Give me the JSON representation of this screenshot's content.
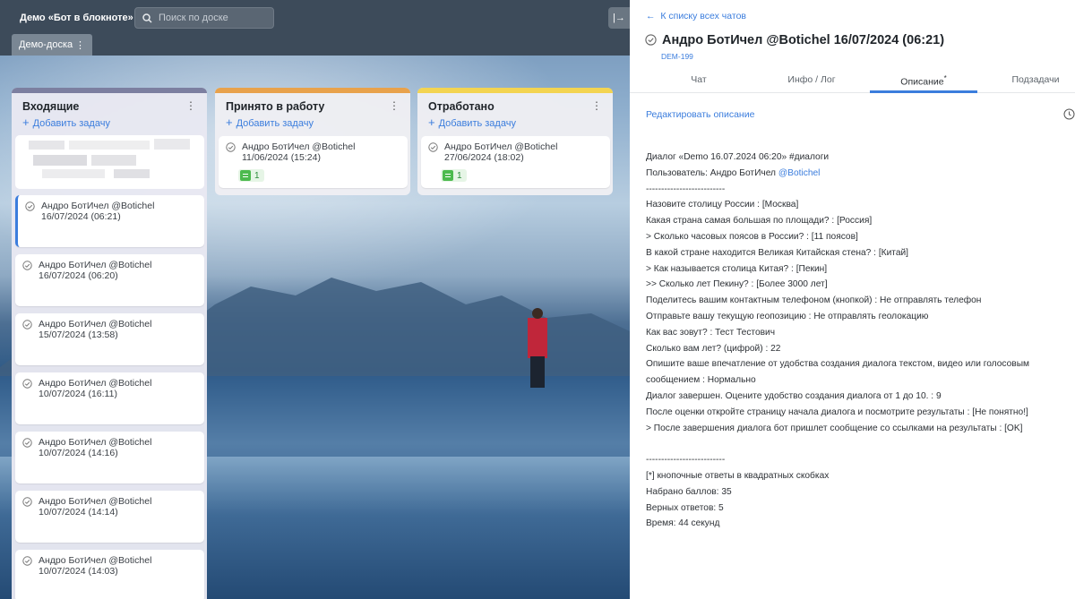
{
  "board": {
    "title": "Демо «Бот в блокноте»",
    "search_placeholder": "Поиск по доске",
    "tab_label": "Демо-доска",
    "collapse_label": "|→",
    "columns": [
      {
        "title": "Входящие",
        "add_label": "Добавить задачу",
        "cards": [
          {
            "title": "Андро БотИчел @Botichel",
            "date": "16/07/2024 (06:21)",
            "active": true
          },
          {
            "title": "Андро БотИчел @Botichel",
            "date": "16/07/2024 (06:20)"
          },
          {
            "title": "Андро БотИчел @Botichel",
            "date": "15/07/2024 (13:58)"
          },
          {
            "title": "Андро БотИчел @Botichel",
            "date": "10/07/2024 (16:11)"
          },
          {
            "title": "Андро БотИчел @Botichel",
            "date": "10/07/2024 (14:16)"
          },
          {
            "title": "Андро БотИчел @Botichel",
            "date": "10/07/2024 (14:14)"
          },
          {
            "title": "Андро БотИчел @Botichel",
            "date": "10/07/2024 (14:03)"
          }
        ]
      },
      {
        "title": "Принято в работу",
        "add_label": "Добавить задачу",
        "cards": [
          {
            "title": "Андро БотИчел @Botichel",
            "date": "11/06/2024 (15:24)",
            "comments": "1"
          }
        ]
      },
      {
        "title": "Отработано",
        "add_label": "Добавить задачу",
        "cards": [
          {
            "title": "Андро БотИчел @Botichel",
            "date": "27/06/2024 (18:02)",
            "comments": "1"
          }
        ]
      }
    ]
  },
  "detail": {
    "back_label": "К списку всех чатов",
    "title": "Андро БотИчел @Botichel 16/07/2024 (06:21)",
    "task_id": "DEM-199",
    "tabs": [
      "Чат",
      "Инфо / Лог",
      "Описание",
      "Подзадачи"
    ],
    "active_tab_marker": "*",
    "edit_label": "Редактировать описание",
    "description": {
      "header": "Диалог «Demo 16.07.2024 06:20» #диалоги",
      "user_prefix": "Пользователь: Андро БотИчел ",
      "user_mention": "@Botichel",
      "separator": "--------------------------",
      "lines": [
        "Назовите столицу России : [Москва]",
        "Какая страна самая большая по площади? : [Россия]",
        "> Сколько часовых поясов в России? : [11 поясов]",
        "В какой стране находится Великая Китайская стена? : [Китай]",
        "> Как называется столица Китая? : [Пекин]",
        ">> Сколько лет Пекину? : [Более 3000 лет]",
        "Поделитесь вашим контактным телефоном (кнопкой) : Не отправлять телефон",
        "Отправьте вашу текущую геопозицию : Не отправлять геолокацию",
        "Как вас зовут? : Тест Тестович",
        "Сколько вам лет? (цифрой) : 22",
        "Опишите ваше впечатление от удобства создания диалога текстом, видео или голосовым",
        "сообщением : Нормально",
        "Диалог завершен. Оцените удобство создания диалога от 1 до 10. : 9",
        "После оценки откройте страницу начала диалога и посмотрите результаты : [Не понятно!]",
        "> После завершения диалога бот пришлет сообщение со ссылками на результаты : [OK]"
      ],
      "separator2": "--------------------------",
      "footer": [
        "[*] кнопочные ответы в квадратных скобках",
        "Набрано баллов: 35",
        "Верных ответов: 5",
        "Время: 44 секунд"
      ]
    }
  }
}
